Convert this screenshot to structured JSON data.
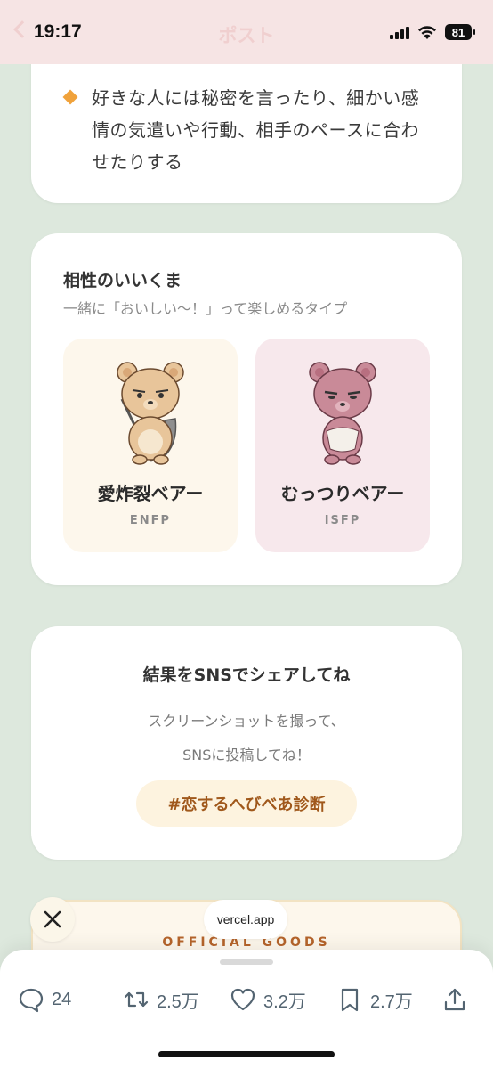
{
  "status_bar": {
    "time": "19:17",
    "title": "ポスト",
    "battery": "81",
    "icons": [
      "back-chevron-icon",
      "signal-icon",
      "wifi-icon",
      "battery-icon"
    ]
  },
  "top_card": {
    "bullet_text": "好きな人には秘密を言ったり、細かい感情の気遣いや行動、相手のペースに合わせたりする"
  },
  "compat": {
    "title": "相性のいいくま",
    "subtitle": "一緒に「おいしい〜！」って楽しめるタイプ",
    "bears": [
      {
        "name": "愛炸裂ベアー",
        "type": "ENFP"
      },
      {
        "name": "むっつりベアー",
        "type": "ISFP"
      }
    ]
  },
  "share": {
    "title": "結果をSNSでシェアしてね",
    "desc_line1": "スクリーンショットを撮って、",
    "desc_line2": "SNSに投稿してね！",
    "hashtag": "#恋するへびべあ診断"
  },
  "goods": {
    "label": "OFFICIAL GOODS"
  },
  "browser": {
    "url": "vercel.app"
  },
  "actions": {
    "reply_count": "24",
    "repost_count": "2.5万",
    "like_count": "3.2万",
    "bookmark_count": "2.7万"
  },
  "colors": {
    "background": "#dde8dd",
    "status_bar": "#f6e4e4",
    "accent_orange": "#f0a23b",
    "hashtag_text": "#a0581b"
  }
}
